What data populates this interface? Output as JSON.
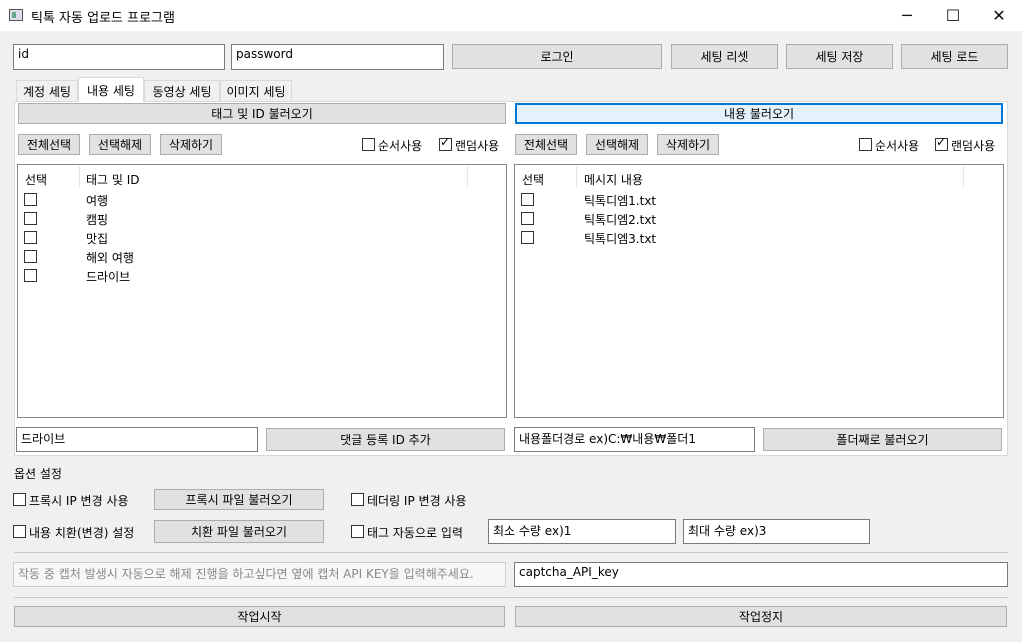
{
  "window": {
    "title": "틱톡 자동 업로드 프로그램",
    "controls": [
      "─",
      "☐",
      "✕"
    ]
  },
  "login": {
    "id_value": "id",
    "password_value": "password",
    "login_label": "로그인",
    "reset_label": "세팅 리셋",
    "save_label": "세팅 저장",
    "load_label": "세팅 로드"
  },
  "tabs": [
    "계정 세팅",
    "내용 세팅",
    "동영상 세팅",
    "이미지 세팅"
  ],
  "left_panel": {
    "load_button": "태그 및 ID 불러오기",
    "select_all": "전체선택",
    "deselect": "선택해제",
    "delete": "삭제하기",
    "order_use": "순서사용",
    "random_use": "랜덤사용",
    "col_select": "선택",
    "col_name": "태그 및 ID",
    "items": [
      "여행",
      "캠핑",
      "맛집",
      "해외 여행",
      "드라이브"
    ],
    "input_value": "드라이브",
    "add_button": "댓글 등록 ID 추가"
  },
  "right_panel": {
    "load_button": "내용 불러오기",
    "select_all": "전체선택",
    "deselect": "선택해제",
    "delete": "삭제하기",
    "order_use": "순서사용",
    "random_use": "랜덤사용",
    "col_select": "선택",
    "col_name": "메시지 내용",
    "items": [
      "틱톡디엠1.txt",
      "틱톡디엠2.txt",
      "틱톡디엠3.txt"
    ],
    "input_value": "내용폴더경로 ex)C:₩내용₩폴더1",
    "folder_button": "폴더째로 불러오기"
  },
  "options": {
    "section_title": "옵션 설정",
    "proxy_ip": "프록시 IP 변경 사용",
    "proxy_file": "프록시 파일 불러오기",
    "tethering_ip": "테더링 IP 변경 사용",
    "replace_setting": "내용 치환(변경) 설정",
    "replace_file": "치환 파일 불러오기",
    "tag_auto": "태그 자동으로 입력",
    "min_count": "최소 수량 ex)1",
    "max_count": "최대 수량 ex)3"
  },
  "captcha": {
    "note": "작동 중 캡처 발생시 자동으로 해제 진행을 하고싶다면 옆에 캡처 API KEY을 입력해주세요.",
    "key_value": "captcha_API_key"
  },
  "actions": {
    "start": "작업시작",
    "stop": "작업정지"
  }
}
